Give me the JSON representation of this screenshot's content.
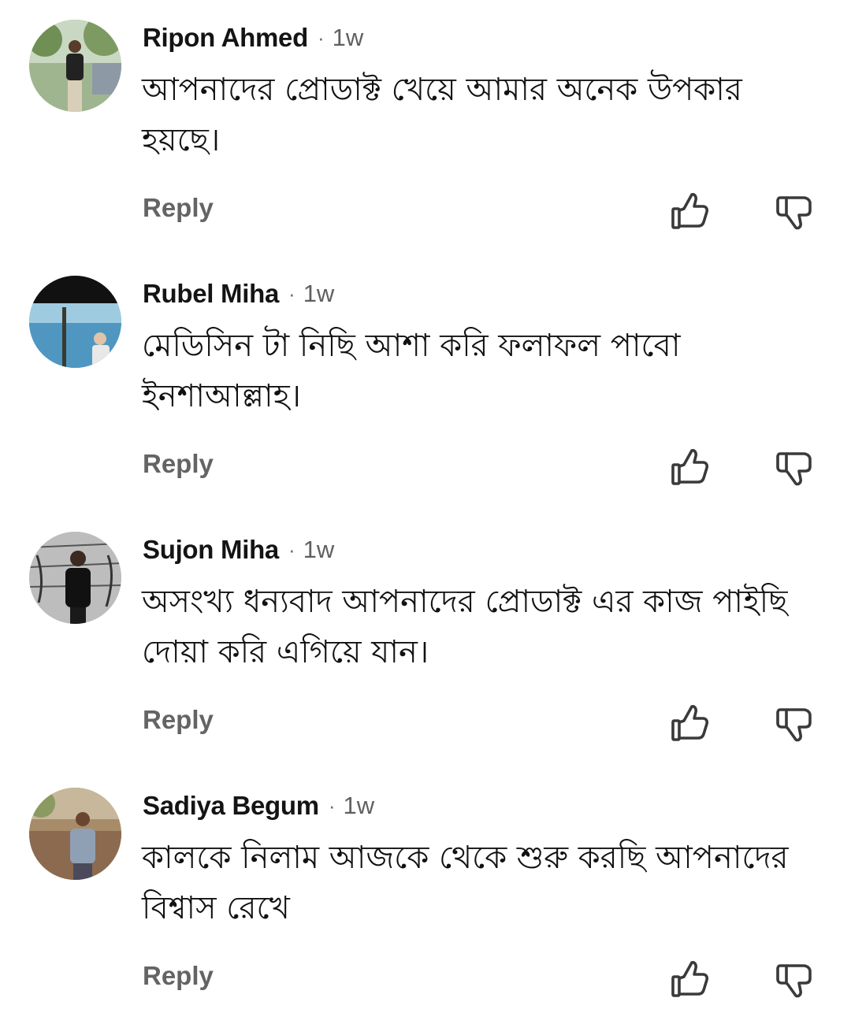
{
  "comments": [
    {
      "author": "Ripon Ahmed",
      "separator": "·",
      "time": "1w",
      "text": "আপনাদের প্রোডাক্ট খেয়ে আমার অনেক উপকার হয়ছে।",
      "reply_label": "Reply",
      "like_icon": "thumbs-up-icon",
      "dislike_icon": "thumbs-down-icon"
    },
    {
      "author": "Rubel Miha",
      "separator": "·",
      "time": "1w",
      "text": "মেডিসিন টা নিছি আশা করি ফলাফল পাবো ইনশাআল্লাহ।",
      "reply_label": "Reply",
      "like_icon": "thumbs-up-icon",
      "dislike_icon": "thumbs-down-icon"
    },
    {
      "author": "Sujon Miha",
      "separator": "·",
      "time": "1w",
      "text": "অসংখ্য ধন্যবাদ আপনাদের প্রোডাক্ট এর কাজ পাইছি দোয়া করি এগিয়ে যান।",
      "reply_label": "Reply",
      "like_icon": "thumbs-up-icon",
      "dislike_icon": "thumbs-down-icon"
    },
    {
      "author": "Sadiya Begum",
      "separator": "·",
      "time": "1w",
      "text": "কালকে নিলাম আজকে থেকে শুরু করছি আপনাদের বিশ্বাস রেখে",
      "reply_label": "Reply",
      "like_icon": "thumbs-up-icon",
      "dislike_icon": "thumbs-down-icon"
    }
  ],
  "colors": {
    "name": "#141414",
    "meta": "#606060",
    "reply": "#646464",
    "icon": "#3a3a3a"
  }
}
